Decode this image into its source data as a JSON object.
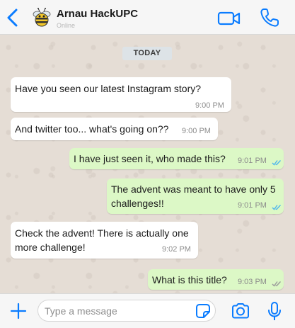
{
  "header": {
    "contact_name": "Arnau HackUPC",
    "status": "Online",
    "accent_color": "#0a7cff"
  },
  "chat": {
    "date_label": "TODAY",
    "messages": [
      {
        "direction": "in",
        "lines": [
          "Have you seen our latest Instagram story?"
        ],
        "time": "9:00 PM"
      },
      {
        "direction": "in",
        "lines": [
          "And twitter too... what's going on??"
        ],
        "time": "9:00 PM"
      },
      {
        "direction": "out",
        "lines": [
          "I have just seen it, who made this?"
        ],
        "time": "9:01 PM",
        "read": true
      },
      {
        "direction": "out",
        "lines": [
          "The advent was meant to have only 5",
          "challenges!!"
        ],
        "time": "9:01 PM",
        "read": true
      },
      {
        "direction": "in",
        "lines": [
          "Check the advent! There is actually one",
          "more challenge!"
        ],
        "time": "9:02 PM"
      },
      {
        "direction": "out",
        "lines": [
          "What is this title?"
        ],
        "time": "9:03 PM",
        "read": false
      }
    ],
    "incoming_bubble_color": "#ffffff",
    "outgoing_bubble_color": "#dcf8c6",
    "read_tick_color": "#4fb6ec",
    "unread_tick_color": "#9a9a9a"
  },
  "composer": {
    "placeholder": "Type a message",
    "value": ""
  },
  "icons": {
    "back": "chevron-left-icon",
    "video": "video-camera-icon",
    "call": "phone-icon",
    "attach": "plus-icon",
    "sticker": "sticker-icon",
    "camera": "camera-icon",
    "mic": "microphone-icon"
  }
}
